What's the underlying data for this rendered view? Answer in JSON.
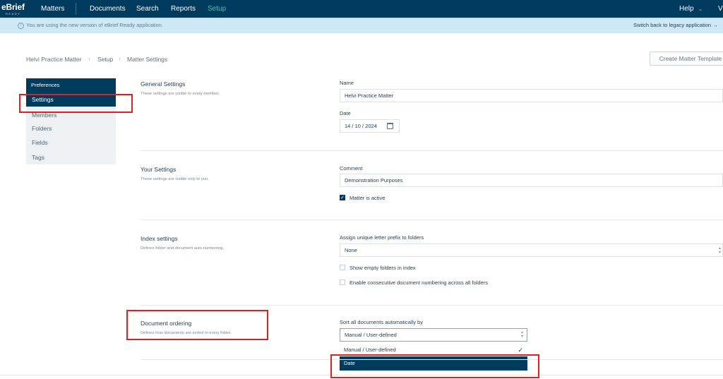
{
  "nav": {
    "logo_main": "eBrief",
    "logo_sub": "READY",
    "items": [
      "Matters",
      "Documents",
      "Search",
      "Reports",
      "Setup"
    ],
    "active": "Setup",
    "help": "Help",
    "user_initial": "V"
  },
  "notice": {
    "message": "You are using the new version of eBrief Ready application.",
    "switch_link": "Switch back to legacy application →"
  },
  "breadcrumb": [
    "Helvi Practice Matter",
    "Setup",
    "Matter Settings"
  ],
  "create_template_button": "Create Matter Template",
  "sidebar": {
    "header": "Preferences",
    "items": [
      "Settings",
      "Members",
      "Folders",
      "Fields",
      "Tags"
    ],
    "active": "Settings"
  },
  "general": {
    "title": "General Settings",
    "desc": "These settings are visible to every member.",
    "name_label": "Name",
    "name_value": "Helvi Practice Matter",
    "date_label": "Date",
    "date_value": "14 / 10 / 2024"
  },
  "your": {
    "title": "Your Settings",
    "desc": "These settings are visible only to you.",
    "comment_label": "Comment",
    "comment_value": "Demonstration Purposes",
    "active_label": "Matter is active"
  },
  "index": {
    "title": "Index settings",
    "desc": "Defines folder and document auto-numbering.",
    "prefix_label": "Assign unique letter prefix to folders",
    "prefix_value": "None",
    "empty_label": "Show empty folders in index",
    "consecutive_label": "Enable consecutive document numbering across all folders"
  },
  "ordering": {
    "title": "Document ordering",
    "desc": "Defines how documents are sorted in every folder.",
    "sort_label": "Sort all documents automatically by",
    "sort_value": "Manual / User-defined",
    "options": [
      "Manual / User-defined",
      "Date"
    ]
  },
  "colors": {
    "nav_bg": "#003a5d",
    "accent": "#3ec7b4",
    "notice_bg": "#cfe8f6",
    "annotation": "#e02020"
  }
}
